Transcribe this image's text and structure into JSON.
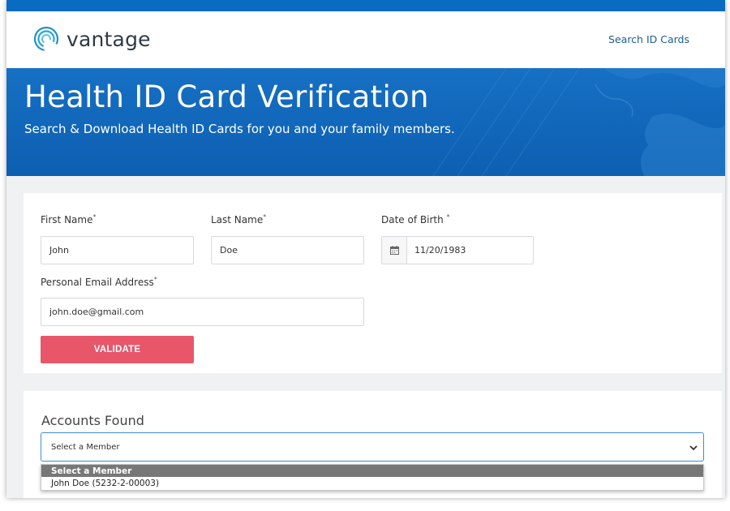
{
  "header": {
    "logo_text": "vantage",
    "nav_link": "Search ID Cards"
  },
  "hero": {
    "title": "Health ID Card Verification",
    "subtitle": "Search & Download Health ID Cards for you and your family members."
  },
  "form": {
    "first_name": {
      "label": "First Name",
      "required": "*",
      "value": "John"
    },
    "last_name": {
      "label": "Last Name",
      "required": "*",
      "value": "Doe"
    },
    "dob": {
      "label": "Date of Birth",
      "required": "*",
      "value": "11/20/1983",
      "icon": "calendar-icon"
    },
    "email": {
      "label": "Personal Email Address",
      "required": "*",
      "value": "john.doe@gmail.com"
    },
    "validate_label": "VALIDATE"
  },
  "accounts": {
    "title": "Accounts Found",
    "select_value": "Select a Member",
    "options": [
      "Select a Member",
      "John Doe (5232-2-00003)"
    ]
  },
  "colors": {
    "brand_blue": "#0a6bc2",
    "validate_red": "#e8566a",
    "link_blue": "#1d5e93"
  }
}
